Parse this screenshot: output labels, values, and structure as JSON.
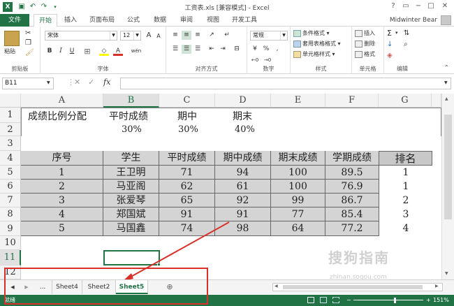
{
  "window": {
    "title": "工资表.xls  [兼容模式] - Excel"
  },
  "menu": {
    "file": "文件",
    "tabs": [
      "开始",
      "插入",
      "页面布局",
      "公式",
      "数据",
      "审阅",
      "视图",
      "开发工具"
    ],
    "user": "Midwinter Bear"
  },
  "ribbon": {
    "clipboard": {
      "label": "剪贴板",
      "paste": "粘贴"
    },
    "font": {
      "label": "字体",
      "name": "宋体",
      "size": "12",
      "bold": "B",
      "italic": "I",
      "underline": "U",
      "grow": "A",
      "shrink": "A",
      "color_a": "A",
      "wen": "wén"
    },
    "alignment": {
      "label": "对齐方式"
    },
    "number": {
      "label": "数字",
      "format": "常规",
      "percent": "%",
      "comma": ","
    },
    "styles": {
      "label": "样式",
      "conditional": "条件格式",
      "table": "套用表格格式",
      "cell": "单元格样式"
    },
    "cells": {
      "label": "单元格",
      "insert": "插入",
      "delete": "删除",
      "format": "格式"
    },
    "editing": {
      "label": "编辑",
      "sum": "Σ"
    }
  },
  "formula_bar": {
    "name_box": "B11",
    "fx": "fx",
    "value": ""
  },
  "grid": {
    "columns": [
      "A",
      "B",
      "C",
      "D",
      "E",
      "F",
      "G"
    ],
    "selected_column": "B",
    "rows": [
      "1",
      "2",
      "3",
      "4",
      "5",
      "6",
      "7",
      "8",
      "9",
      "10",
      "11",
      "12"
    ],
    "selected_row": "11",
    "r1": {
      "a": "成绩比例分配",
      "b": "平时成绩",
      "c": "期中",
      "d": "期末"
    },
    "r2": {
      "b": "30%",
      "c": "30%",
      "d": "40%"
    },
    "headers": [
      "序号",
      "学生",
      "平时成绩",
      "期中成绩",
      "期末成绩",
      "学期成绩"
    ],
    "rank_header": "排名",
    "records": [
      {
        "no": "1",
        "name": "王卫明",
        "usual": "71",
        "mid": "94",
        "final": "100",
        "term": "89.5",
        "rank": "1"
      },
      {
        "no": "2",
        "name": "马亚阁",
        "usual": "62",
        "mid": "61",
        "final": "100",
        "term": "76.9",
        "rank": "1"
      },
      {
        "no": "3",
        "name": "张爱琴",
        "usual": "65",
        "mid": "92",
        "final": "99",
        "term": "86.7",
        "rank": "2"
      },
      {
        "no": "4",
        "name": "郑国斌",
        "usual": "91",
        "mid": "91",
        "final": "77",
        "term": "85.4",
        "rank": "3"
      },
      {
        "no": "5",
        "name": "马国鑫",
        "usual": "74",
        "mid": "98",
        "final": "64",
        "term": "77.2",
        "rank": "4"
      }
    ]
  },
  "sheets": {
    "ellipsis": "...",
    "tabs": [
      "Sheet4",
      "Sheet2",
      "Sheet5"
    ],
    "active": "Sheet5",
    "add": "⊕"
  },
  "status": {
    "ready": "就绪",
    "zoom": "151%"
  },
  "watermark": {
    "text": "搜狗指南",
    "url": "zhinan.sogou.com"
  },
  "colors": {
    "excel_green": "#217346",
    "highlight_red": "#d8312b",
    "table_fill": "#d4d4d4"
  }
}
